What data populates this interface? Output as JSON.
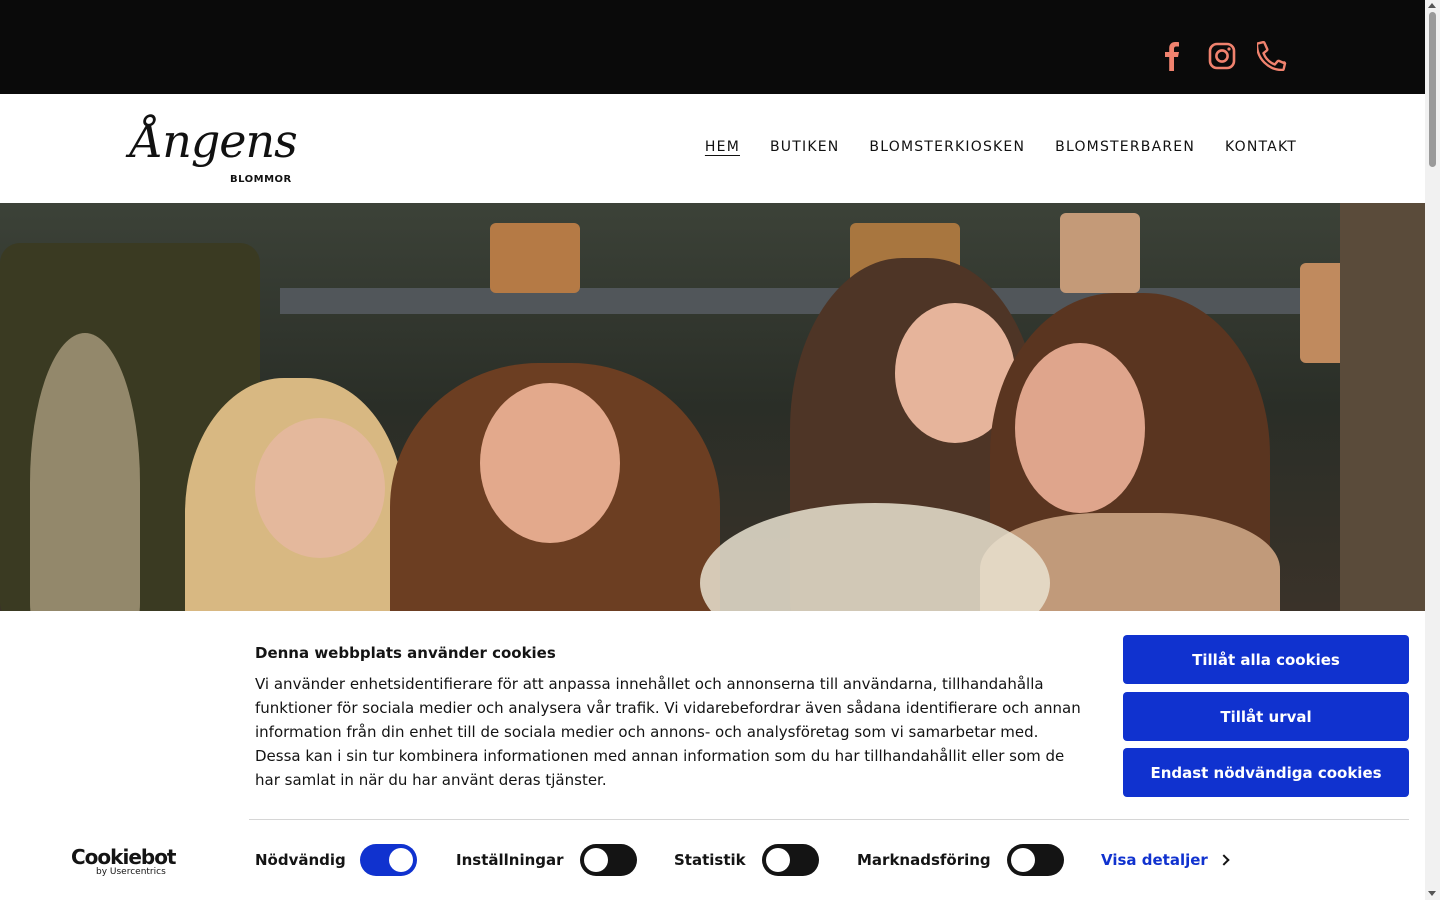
{
  "colors": {
    "accent_social": "#f0826e",
    "button_blue": "#1032cf",
    "topbar": "#0a0a0a"
  },
  "social": [
    {
      "name": "facebook-icon"
    },
    {
      "name": "instagram-icon"
    },
    {
      "name": "phone-icon"
    }
  ],
  "logo": {
    "word": "Ångens",
    "sub": "BLOMMOR"
  },
  "nav": {
    "items": [
      {
        "label": "HEM",
        "active": true
      },
      {
        "label": "BUTIKEN"
      },
      {
        "label": "BLOMSTERKIOSKEN"
      },
      {
        "label": "BLOMSTERBAREN"
      },
      {
        "label": "KONTAKT"
      }
    ]
  },
  "cookie": {
    "title": "Denna webbplats använder cookies",
    "body": "Vi använder enhetsidentifierare för att anpassa innehållet och annonserna till användarna, tillhandahålla funktioner för sociala medier och analysera vår trafik. Vi vidarebefordrar även sådana identifierare och annan information från din enhet till de sociala medier och annons- och analysföretag som vi samarbetar med. Dessa kan i sin tur kombinera informationen med annan information som du har tillhandahållit eller som de har samlat in när du har använt deras tjänster.",
    "buttons": {
      "allow_all": "Tillåt alla cookies",
      "allow_selection": "Tillåt urval",
      "necessary_only": "Endast nödvändiga cookies"
    },
    "brand": {
      "word": "Cookiebot",
      "sub": "by Usercentrics"
    },
    "toggles": [
      {
        "label": "Nödvändig",
        "on": true
      },
      {
        "label": "Inställningar",
        "on": false
      },
      {
        "label": "Statistik",
        "on": false
      },
      {
        "label": "Marknadsföring",
        "on": false
      }
    ],
    "details_label": "Visa detaljer"
  }
}
